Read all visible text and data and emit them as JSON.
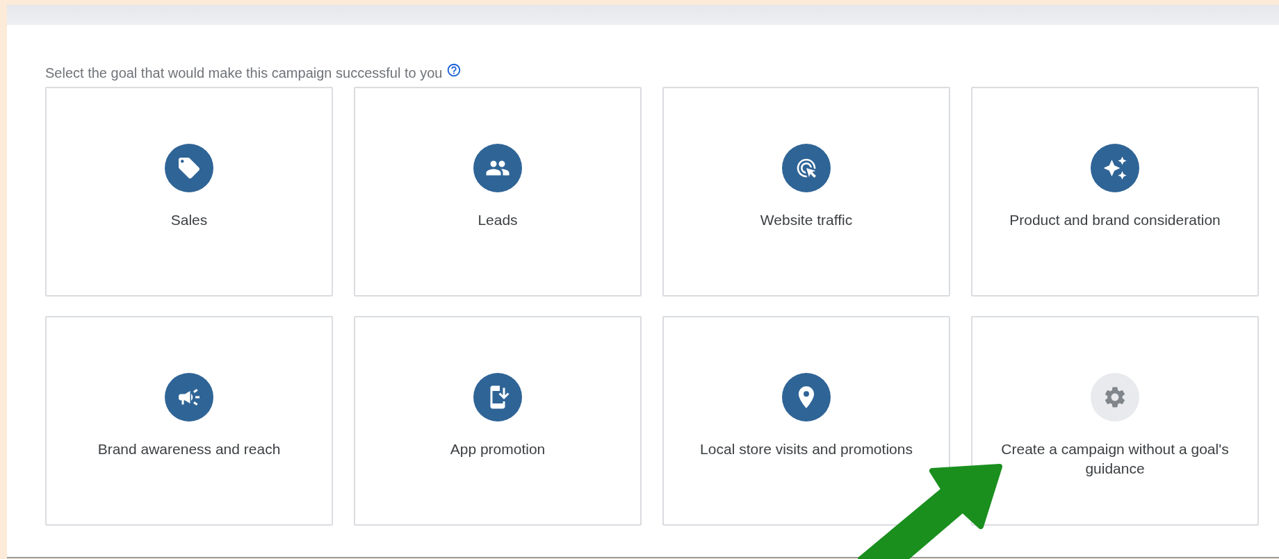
{
  "heading": "Select the goal that would make this campaign successful to you",
  "goals": [
    {
      "label": "Sales",
      "kind": "tag"
    },
    {
      "label": "Leads",
      "kind": "people"
    },
    {
      "label": "Website traffic",
      "kind": "click"
    },
    {
      "label": "Product and brand consideration",
      "kind": "sparkle"
    },
    {
      "label": "Brand awareness and reach",
      "kind": "megaphone"
    },
    {
      "label": "App promotion",
      "kind": "phone"
    },
    {
      "label": "Local store visits and promotions",
      "kind": "pin"
    },
    {
      "label": "Create a campaign without a goal's guidance",
      "kind": "gear"
    }
  ]
}
